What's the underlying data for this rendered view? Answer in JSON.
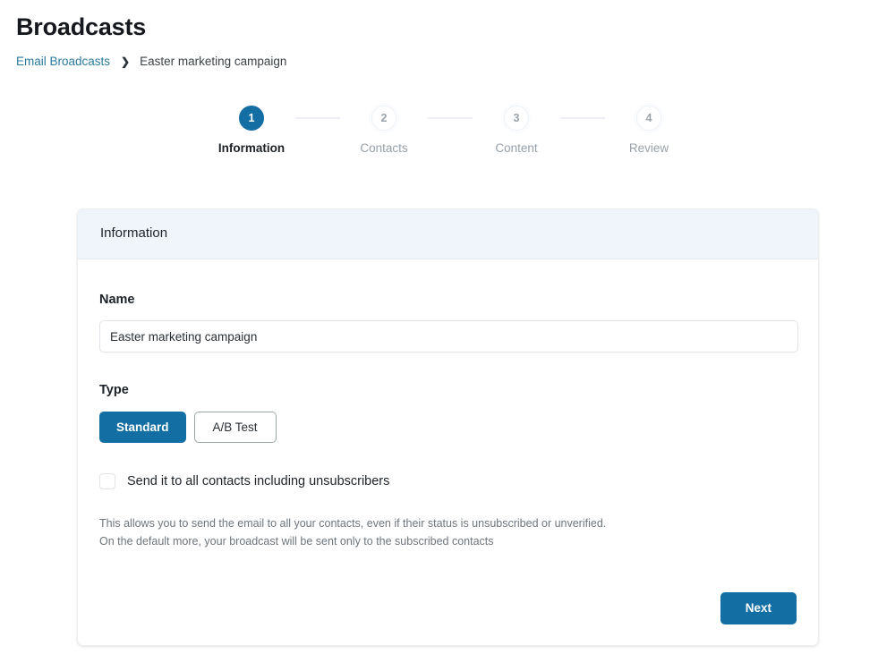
{
  "header": {
    "title": "Broadcasts",
    "breadcrumb": {
      "link_label": "Email Broadcasts",
      "separator": "›",
      "current_label": "Easter marketing campaign"
    }
  },
  "stepper": {
    "steps": [
      {
        "number": "1",
        "label": "Information",
        "state": "active"
      },
      {
        "number": "2",
        "label": "Contacts",
        "state": "inactive"
      },
      {
        "number": "3",
        "label": "Content",
        "state": "inactive"
      },
      {
        "number": "4",
        "label": "Review",
        "state": "inactive"
      }
    ]
  },
  "card": {
    "header_title": "Information",
    "name_field": {
      "label": "Name",
      "value": "Easter marketing campaign",
      "placeholder": "Name"
    },
    "type_field": {
      "label": "Type",
      "options": [
        {
          "label": "Standard",
          "selected": true
        },
        {
          "label": "A/B Test",
          "selected": false
        }
      ]
    },
    "unsubscribers_checkbox": {
      "label": "Send it to all contacts including unsubscribers",
      "checked": false
    },
    "help_text": {
      "line1": "This allows you to send the email to all your contacts, even if their status is unsubscribed or unverified.",
      "line2": "On the default more, your broadcast will be sent only to the subscribed contacts"
    },
    "next_button": "Next"
  },
  "colors": {
    "accent_blue": "#136ea4",
    "link_teal": "#2c7a9b",
    "card_header_bg": "#eff5fb",
    "outline_border": "#9aa8a5",
    "connector": "#eeeff7"
  }
}
